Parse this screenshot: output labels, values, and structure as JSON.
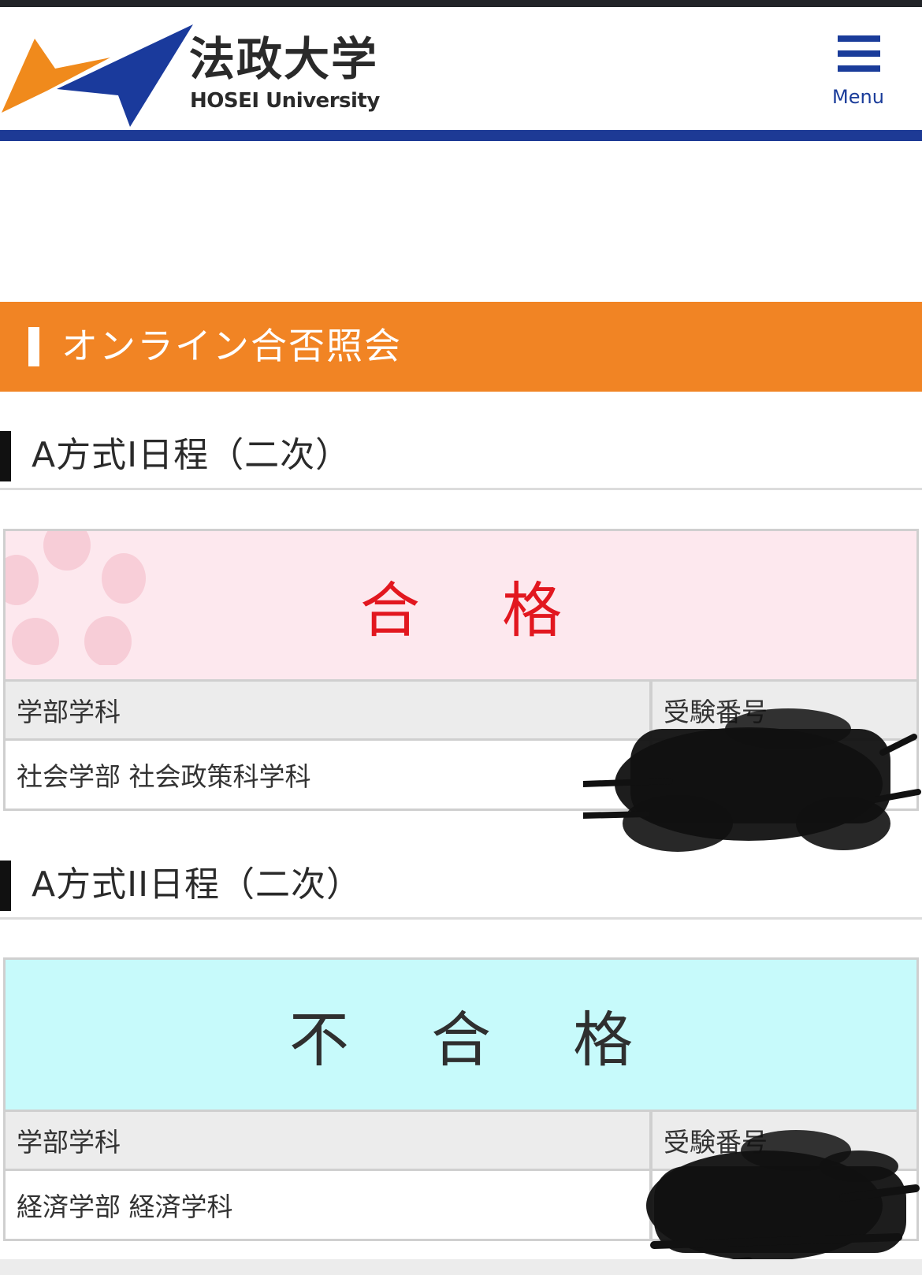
{
  "header": {
    "logo_ja": "法政大学",
    "logo_en": "HOSEI University",
    "menu_label": "Menu",
    "menu_icon": "hamburger-icon",
    "brand_navy": "#1d3a95",
    "brand_orange": "#f08a1c"
  },
  "banner": {
    "title": "オンライン合否照会",
    "color": "#f18424"
  },
  "sections": [
    {
      "heading": "A方式I日程（二次）",
      "result": "合 格",
      "result_color": "#e2171f",
      "result_background": "#fde8ee",
      "decoration": "cherry-blossom-icon",
      "table": {
        "headers": [
          "学部学科",
          "受験番号"
        ],
        "row": [
          "社会学部 社会政策科学科",
          ""
        ]
      }
    },
    {
      "heading": "A方式II日程（二次）",
      "result": "不 合 格",
      "result_color": "#2f2f2f",
      "result_background": "#c7fafb",
      "table": {
        "headers": [
          "学部学科",
          "受験番号"
        ],
        "row": [
          "経済学部 経済学科",
          ""
        ]
      }
    }
  ]
}
